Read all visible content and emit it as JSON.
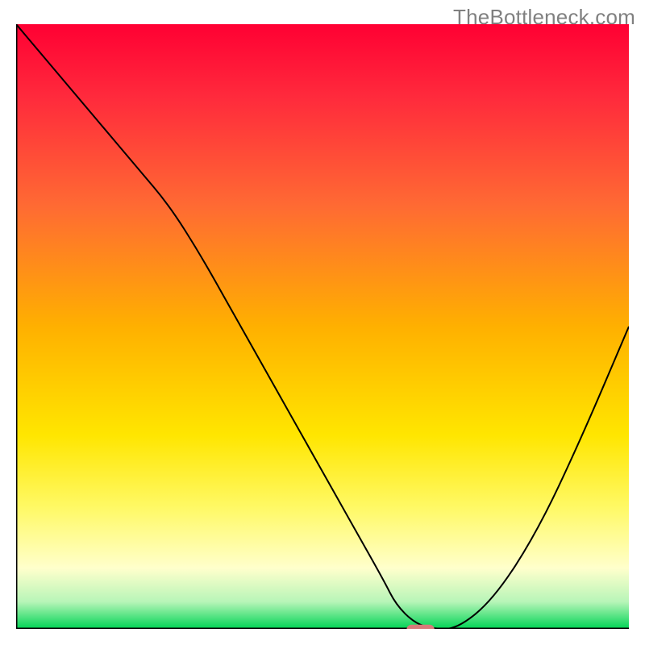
{
  "watermark": "TheBottleneck.com",
  "chart_data": {
    "type": "line",
    "title": "",
    "xlabel": "",
    "ylabel": "",
    "xlim": [
      0,
      100
    ],
    "ylim": [
      0,
      100
    ],
    "grid": false,
    "legend": false,
    "gradient_background": {
      "stops": [
        {
          "offset": 0.0,
          "color": "#ff0033"
        },
        {
          "offset": 0.12,
          "color": "#ff2a3c"
        },
        {
          "offset": 0.3,
          "color": "#ff6a33"
        },
        {
          "offset": 0.5,
          "color": "#ffb000"
        },
        {
          "offset": 0.68,
          "color": "#ffe600"
        },
        {
          "offset": 0.8,
          "color": "#fff966"
        },
        {
          "offset": 0.9,
          "color": "#ffffcc"
        },
        {
          "offset": 0.955,
          "color": "#b8f5b8"
        },
        {
          "offset": 1.0,
          "color": "#00d455"
        }
      ]
    },
    "curve": {
      "name": "bottleneck-curve",
      "color": "#000000",
      "width": 2,
      "x": [
        0,
        5,
        10,
        15,
        20,
        25,
        30,
        35,
        40,
        45,
        50,
        55,
        60,
        62,
        65,
        68,
        72,
        78,
        85,
        92,
        100
      ],
      "y": [
        100,
        94,
        88,
        82,
        76,
        70,
        62,
        53,
        44,
        35,
        26,
        17,
        8,
        4,
        1,
        0,
        0,
        5,
        16,
        31,
        50
      ]
    },
    "marker": {
      "name": "optimal-point",
      "shape": "rounded-rect",
      "color": "#d87a7a",
      "x": 66,
      "y": 0,
      "width_pct": 4.5,
      "height_pct": 1.4
    },
    "axes": {
      "left": {
        "from": [
          0,
          0
        ],
        "to": [
          0,
          100
        ],
        "color": "#000000"
      },
      "bottom": {
        "from": [
          0,
          0
        ],
        "to": [
          100,
          0
        ],
        "color": "#000000"
      }
    }
  }
}
